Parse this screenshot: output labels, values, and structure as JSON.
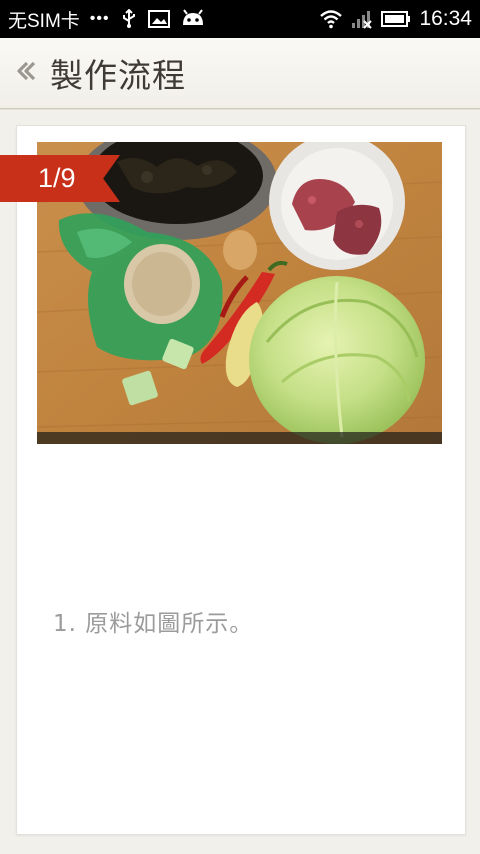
{
  "status_bar": {
    "carrier": "无SIM卡",
    "dots": "•••",
    "time": "16:34",
    "icons": [
      "usb-icon",
      "image-icon",
      "android-icon",
      "wifi-icon",
      "signal-icon",
      "battery-icon"
    ]
  },
  "header": {
    "title": "製作流程",
    "back_icon": "chevron-left-icon"
  },
  "step": {
    "counter": "1/9",
    "description": "1. 原料如圖所示。",
    "image_icon": "ingredients-photo"
  },
  "colors": {
    "badge": "#c8301a",
    "title_text": "#3f3a36",
    "step_text": "#9b9b9b",
    "background": "#f1f0eb"
  }
}
